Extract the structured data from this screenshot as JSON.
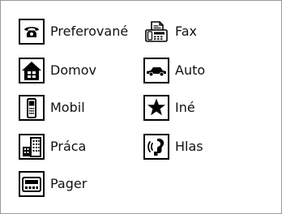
{
  "panel": {
    "items": [
      {
        "key": "preferovane",
        "label": "Preferované",
        "icon": "telephone-icon"
      },
      {
        "key": "domov",
        "label": "Domov",
        "icon": "home-icon"
      },
      {
        "key": "mobil",
        "label": "Mobil",
        "icon": "mobile-phone-icon"
      },
      {
        "key": "praca",
        "label": "Práca",
        "icon": "office-buildings-icon"
      },
      {
        "key": "pager",
        "label": "Pager",
        "icon": "pager-icon"
      },
      {
        "key": "fax",
        "label": "Fax",
        "icon": "fax-icon"
      },
      {
        "key": "auto",
        "label": "Auto",
        "icon": "car-icon"
      },
      {
        "key": "ine",
        "label": "Iné",
        "icon": "star-icon"
      },
      {
        "key": "hlas",
        "label": "Hlas",
        "icon": "voice-icon"
      }
    ]
  },
  "colors": {
    "icon_fg": "#000000",
    "icon_bg": "#ffffff",
    "panel_border": "#9a9a9a",
    "page_bg": "#e6e6e6"
  }
}
